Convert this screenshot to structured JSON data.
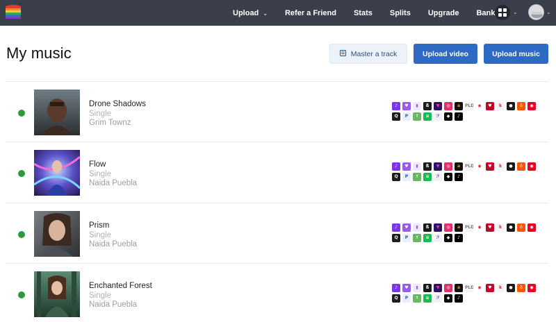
{
  "nav": {
    "items": [
      {
        "label": "Upload",
        "caret": true
      },
      {
        "label": "Refer a Friend",
        "caret": false
      },
      {
        "label": "Stats",
        "caret": false
      },
      {
        "label": "Splits",
        "caret": false
      },
      {
        "label": "Upgrade",
        "caret": false
      },
      {
        "label": "Bank",
        "caret": false
      }
    ]
  },
  "page": {
    "title": "My music",
    "buttons": {
      "master": "Master a track",
      "video": "Upload video",
      "music": "Upload music"
    }
  },
  "tracks": [
    {
      "title": "Drone Shadows",
      "type": "Single",
      "artist": "Grim Townz",
      "cover_caption": "Drone Shadows\ngrim townz"
    },
    {
      "title": "Flow",
      "type": "Single",
      "artist": "Naida Puebla",
      "cover_caption": "Naida Puebla\nFlow"
    },
    {
      "title": "Prism",
      "type": "Single",
      "artist": "Naida Puebla",
      "cover_caption": "Naida Puebla\nPrism"
    },
    {
      "title": "Enchanted Forest",
      "type": "Single",
      "artist": "Naida Puebla",
      "cover_caption": "Naida Puebla\nEnchanted Forest"
    }
  ],
  "platform_icons": {
    "row1": [
      {
        "name": "apple-music-icon",
        "glyph": "♪",
        "bg": "#7d35e8",
        "fg": "#ffffff"
      },
      {
        "name": "napster-icon",
        "glyph": "♥",
        "bg": "#9a5cf0",
        "fg": "#ffffff"
      },
      {
        "name": "deezer-icon",
        "glyph": "▮",
        "bg": "#f1e8fb",
        "fg": "#9a5cf0"
      },
      {
        "name": "beatport-icon",
        "glyph": "ß",
        "bg": "#1b1b1b",
        "fg": "#ffffff"
      },
      {
        "name": "claro-icon",
        "glyph": "▼",
        "bg": "#2a1460",
        "fg": "#ff3a8c"
      },
      {
        "name": "instagram-icon",
        "glyph": "◎",
        "bg": "#e1306c",
        "fg": "#ffffff"
      },
      {
        "name": "amazon-icon",
        "glyph": "a",
        "bg": "#111111",
        "fg": "#ff9900"
      },
      {
        "name": "pld-icon",
        "glyph": "PLD",
        "bg": "#f4f4f4",
        "fg": "#777777"
      },
      {
        "name": "target-icon",
        "glyph": "◉",
        "bg": "#ffffff",
        "fg": "#d8232a"
      },
      {
        "name": "iheart-icon",
        "glyph": "♥",
        "bg": "#c6002b",
        "fg": "#ffffff"
      },
      {
        "name": "kkbox-icon",
        "glyph": "k",
        "bg": "#f4f4f4",
        "fg": "#d8232a"
      },
      {
        "name": "audiomack-icon",
        "glyph": "●",
        "bg": "#1a1a1a",
        "fg": "#ffffff"
      },
      {
        "name": "soundcloud-icon",
        "glyph": "♁",
        "bg": "#ff5500",
        "fg": "#ffffff"
      },
      {
        "name": "netease-icon",
        "glyph": "◉",
        "bg": "#e60026",
        "fg": "#ffffff"
      }
    ],
    "row2": [
      {
        "name": "qobuz-icon",
        "glyph": "Q",
        "bg": "#1e1e1e",
        "fg": "#ffffff"
      },
      {
        "name": "pandora-icon",
        "glyph": "P",
        "bg": "#e8eefb",
        "fg": "#2a55c4"
      },
      {
        "name": "upload-icon",
        "glyph": "↑",
        "bg": "#66b960",
        "fg": "#ffffff"
      },
      {
        "name": "spotify-icon",
        "glyph": "≋",
        "bg": "#1db954",
        "fg": "#ffffff"
      },
      {
        "name": "anghami-icon",
        "glyph": "ℱ",
        "bg": "#f2f2f2",
        "fg": "#7a3fe0"
      },
      {
        "name": "tidal-icon",
        "glyph": "◆",
        "bg": "#0d0d0d",
        "fg": "#ffffff"
      },
      {
        "name": "tiktok-icon",
        "glyph": "♪",
        "bg": "#000000",
        "fg": "#ffffff"
      }
    ]
  }
}
